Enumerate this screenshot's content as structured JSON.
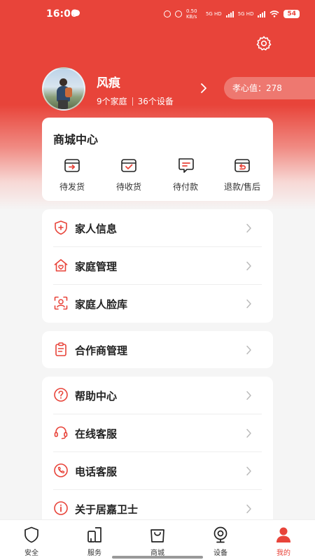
{
  "status_bar": {
    "time": "16:06",
    "net_speed": "0.50 KB/s",
    "signal_1": "5G HD",
    "signal_2": "5G HD",
    "battery": "54"
  },
  "profile": {
    "name": "风痕",
    "families": "9个家庭",
    "devices": "36个设备",
    "filial_value": "孝心值：278"
  },
  "shop_center": {
    "title": "商城中心",
    "items": [
      {
        "label": "待发货",
        "icon": "shipment-pending-icon"
      },
      {
        "label": "待收货",
        "icon": "receipt-pending-icon"
      },
      {
        "label": "待付款",
        "icon": "payment-pending-icon"
      },
      {
        "label": "退款/售后",
        "icon": "refund-icon"
      }
    ]
  },
  "family_menu": [
    {
      "label": "家人信息",
      "icon": "shield-plus-icon"
    },
    {
      "label": "家庭管理",
      "icon": "home-heart-icon"
    },
    {
      "label": "家庭人脸库",
      "icon": "face-scan-icon"
    }
  ],
  "partner_menu": [
    {
      "label": "合作商管理",
      "icon": "clipboard-icon"
    }
  ],
  "help_menu": [
    {
      "label": "帮助中心",
      "icon": "question-icon"
    },
    {
      "label": "在线客服",
      "icon": "headset-icon"
    },
    {
      "label": "电话客服",
      "icon": "phone-icon"
    },
    {
      "label": "关于居嘉卫士",
      "icon": "info-icon"
    }
  ],
  "tabbar": {
    "active": "我的",
    "tabs": [
      {
        "label": "安全",
        "icon": "shield-icon"
      },
      {
        "label": "服务",
        "icon": "service-icon"
      },
      {
        "label": "商城",
        "icon": "shopping-bag-icon"
      },
      {
        "label": "设备",
        "icon": "camera-icon"
      },
      {
        "label": "我的",
        "icon": "user-icon"
      }
    ]
  },
  "colors": {
    "brand": "#e8443a",
    "icon_red": "#e8443a",
    "text": "#222222"
  }
}
